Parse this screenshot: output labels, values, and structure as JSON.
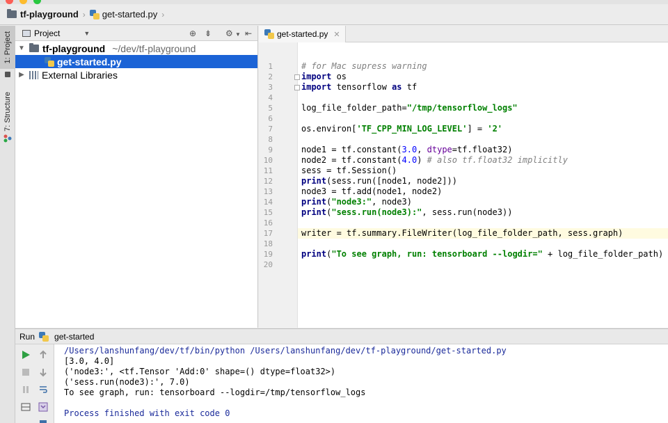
{
  "navbar": {
    "project": "tf-playground",
    "file": "get-started.py"
  },
  "toolstrip": {
    "project_tab": "1: Project",
    "structure_tab": "7: Structure"
  },
  "project_panel": {
    "header": "Project",
    "root": {
      "name": "tf-playground",
      "path": "~/dev/tf-playground"
    },
    "selected_file": "get-started.py",
    "external": "External Libraries"
  },
  "editor": {
    "tab_label": "get-started.py",
    "current_line": 17,
    "line_count": 20
  },
  "code_lines": [
    "# for Mac supress warning",
    "import os",
    "import tensorflow as tf",
    "",
    "log_file_folder_path=\"/tmp/tensorflow_logs\"",
    "",
    "os.environ['TF_CPP_MIN_LOG_LEVEL'] = '2'",
    "",
    "node1 = tf.constant(3.0, dtype=tf.float32)",
    "node2 = tf.constant(4.0) # also tf.float32 implicitly",
    "sess = tf.Session()",
    "print(sess.run([node1, node2]))",
    "node3 = tf.add(node1, node2)",
    "print(\"node3:\", node3)",
    "print(\"sess.run(node3):\", sess.run(node3))",
    "",
    "writer = tf.summary.FileWriter(log_file_folder_path, sess.graph)",
    "",
    "print(\"To see graph, run: tensorboard --logdir=\" + log_file_folder_path)",
    ""
  ],
  "run_panel": {
    "label": "Run",
    "config": "get-started",
    "output": [
      "/Users/lanshunfang/dev/tf/bin/python /Users/lanshunfang/dev/tf-playground/get-started.py",
      "[3.0, 4.0]",
      "('node3:', <tf.Tensor 'Add:0' shape=() dtype=float32>)",
      "('sess.run(node3):', 7.0)",
      "To see graph, run: tensorboard --logdir=/tmp/tensorflow_logs",
      "",
      "Process finished with exit code 0"
    ]
  },
  "colors": {
    "selection": "#1b63d6",
    "keyword": "#000080",
    "string": "#008000",
    "comment": "#808080",
    "number": "#0000ff",
    "current_line": "#fffbe0",
    "run_green": "#2ea043"
  }
}
